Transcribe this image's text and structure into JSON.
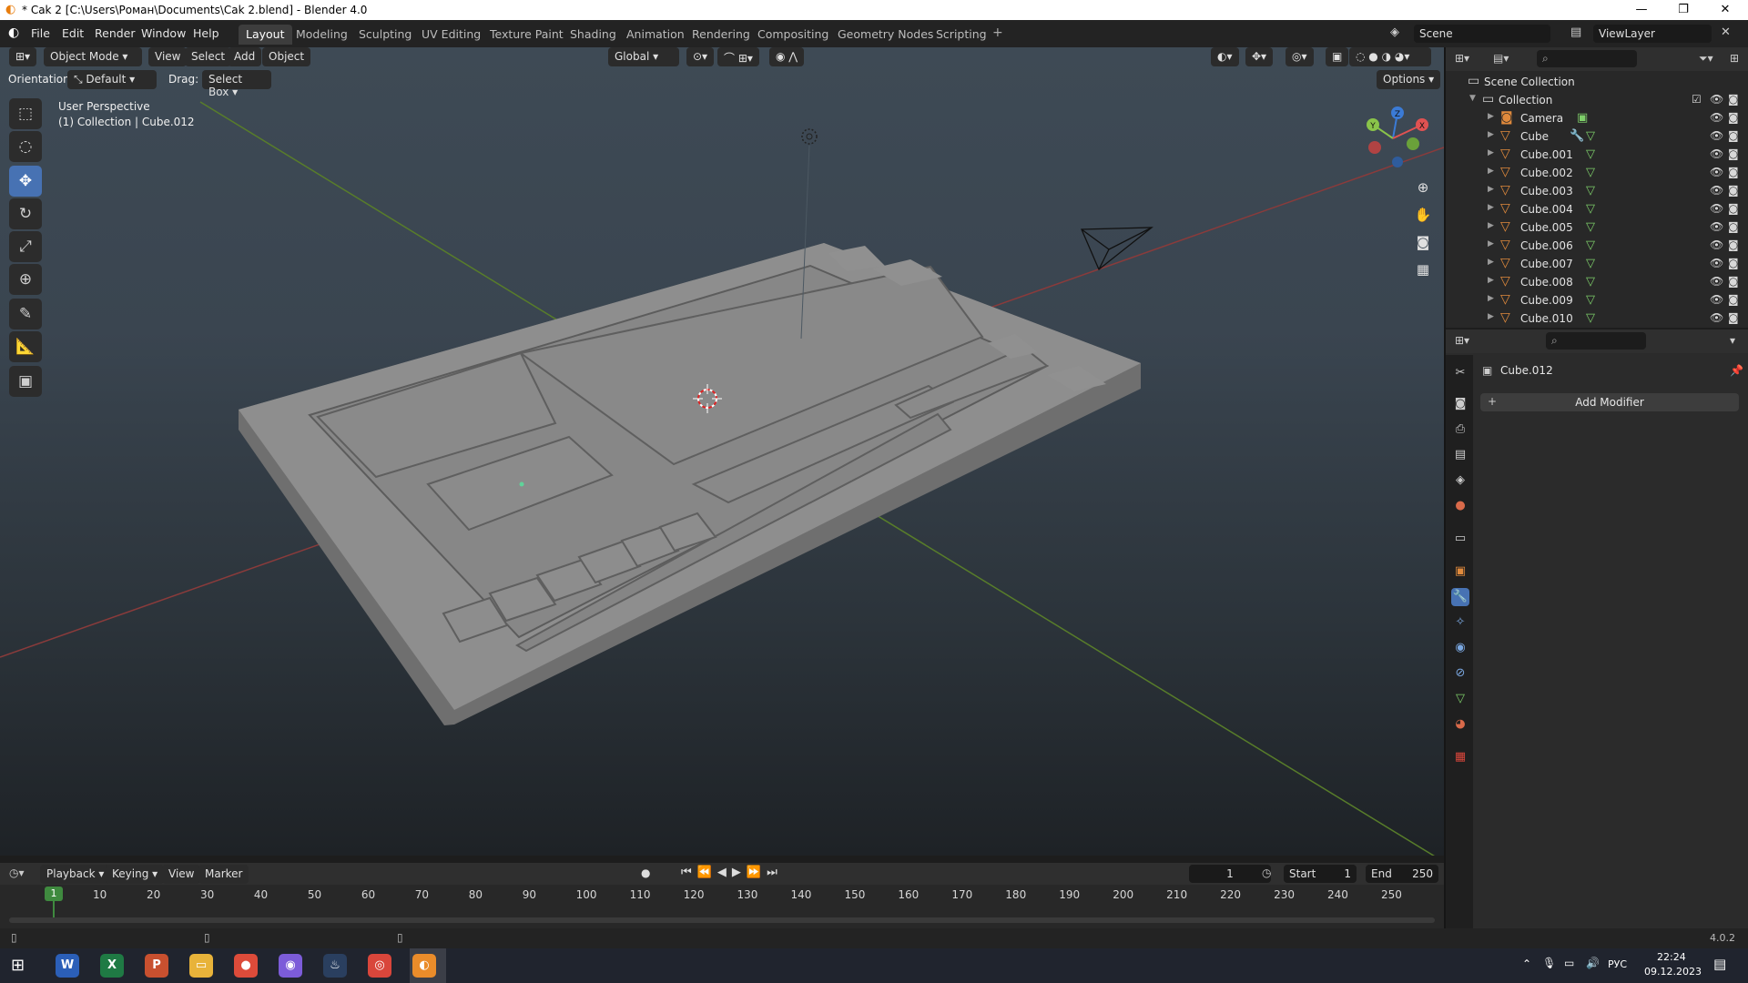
{
  "window": {
    "title": "* Cak 2 [C:\\Users\\Роман\\Documents\\Cak 2.blend] - Blender 4.0",
    "minimize": "—",
    "restore": "❐",
    "close": "✕"
  },
  "menu": [
    "File",
    "Edit",
    "Render",
    "Window",
    "Help"
  ],
  "workspaces": [
    "Layout",
    "Modeling",
    "Sculpting",
    "UV Editing",
    "Texture Paint",
    "Shading",
    "Animation",
    "Rendering",
    "Compositing",
    "Geometry Nodes",
    "Scripting"
  ],
  "active_workspace": "Layout",
  "scene": {
    "name": "Scene",
    "view_layer": "ViewLayer"
  },
  "viewport_header": {
    "mode": "Object Mode",
    "menus": [
      "View",
      "Select",
      "Add",
      "Object"
    ],
    "transform_orientation": "Global",
    "orientation_label": "Orientation:",
    "orientation_value": "Default",
    "drag_label": "Drag:",
    "drag_value": "Select Box",
    "options": "Options"
  },
  "viewport_info": {
    "perspective": "User Perspective",
    "collection": "(1) Collection | Cube.012"
  },
  "gizmo": {
    "z": "Z",
    "y": "Y",
    "x": "X"
  },
  "outliner": {
    "root": "Scene Collection",
    "collection": "Collection",
    "items": [
      "Camera",
      "Cube",
      "Cube.001",
      "Cube.002",
      "Cube.003",
      "Cube.004",
      "Cube.005",
      "Cube.006",
      "Cube.007",
      "Cube.008",
      "Cube.009",
      "Cube.010"
    ]
  },
  "properties": {
    "object_name": "Cube.012",
    "add_modifier": "Add Modifier"
  },
  "timeline": {
    "menus": [
      "Playback",
      "Keying",
      "View",
      "Marker"
    ],
    "current_frame": "1",
    "start_label": "Start",
    "start": "1",
    "end_label": "End",
    "end": "250",
    "ticks": [
      "10",
      "20",
      "30",
      "40",
      "50",
      "60",
      "70",
      "80",
      "90",
      "100",
      "110",
      "120",
      "130",
      "140",
      "150",
      "160",
      "170",
      "180",
      "190",
      "200",
      "210",
      "220",
      "230",
      "240",
      "250"
    ],
    "playhead": "1"
  },
  "status": {
    "version": "4.0.2"
  },
  "taskbar": {
    "lang": "РУС",
    "time": "22:24",
    "date": "09.12.2023",
    "apps": [
      {
        "name": "W",
        "color": "#2b5fb8"
      },
      {
        "name": "X",
        "color": "#1f7a44"
      },
      {
        "name": "P",
        "color": "#c8502f"
      },
      {
        "name": "▭",
        "color": "#e8b33a"
      },
      {
        "name": "●",
        "color": "#dd4b3a"
      },
      {
        "name": "◉",
        "color": "#7c5cd9"
      },
      {
        "name": "♨",
        "color": "#2a3f5f"
      },
      {
        "name": "◎",
        "color": "#d9463b"
      },
      {
        "name": "◐",
        "color": "#e87d0d"
      }
    ]
  }
}
